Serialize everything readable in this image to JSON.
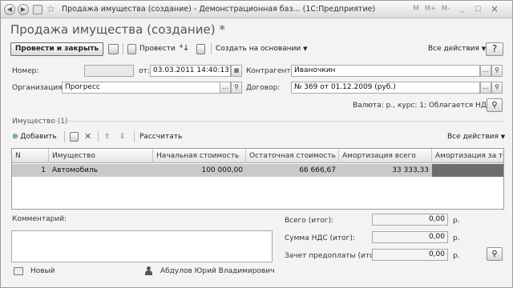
{
  "window": {
    "title": "Продажа имущества (создание) - Демонстрационная баз... (1С:Предприятие)",
    "controls": {
      "m": "M",
      "m_plus": "M+",
      "m_minus": "M-",
      "minimize": "_",
      "maximize": "□",
      "close": "×"
    }
  },
  "form": {
    "title": "Продажа имущества (создание) *"
  },
  "toolbar": {
    "post_and_close": "Провести и закрыть",
    "post": "Провести",
    "create_based_on": "Создать на основании",
    "all_actions": "Все действия"
  },
  "fields": {
    "number_label": "Номер:",
    "number_value": "",
    "date_label": "от:",
    "date_value": "03.03.2011 14:40:13",
    "org_label": "Организация:",
    "org_value": "Прогресс",
    "counterparty_label": "Контрагент:",
    "counterparty_value": "Иваночкин",
    "contract_label": "Договор:",
    "contract_value": "№ 369 от 01.12.2009 (руб.)",
    "currency_info": "Валюта: р., курс: 1; Облагается НДС"
  },
  "assets_section": {
    "title": "Имущество (1)",
    "add": "Добавить",
    "calculate": "Рассчитать",
    "all_actions": "Все действия"
  },
  "table": {
    "columns": [
      "N",
      "Имущество",
      "Начальная стоимость",
      "Остаточная стоимость",
      "Амортизация всего",
      "Амортизация за тек"
    ],
    "rows": [
      [
        "1",
        "Автомобиль",
        "100 000,00",
        "66 666,67",
        "33 333,33",
        ""
      ]
    ]
  },
  "comment": {
    "label": "Комментарий:",
    "value": ""
  },
  "totals": {
    "total_label": "Всего (итог):",
    "total_value": "0,00",
    "vat_label": "Сумма НДС (итог):",
    "vat_value": "0,00",
    "prepay_label": "Зачет предоплаты (итог):",
    "prepay_value": "0,00",
    "currency": "р."
  },
  "status": {
    "state": "Новый",
    "author": "Абдулов Юрий Владимирович"
  },
  "icons": {
    "back": "arrow-left-icon",
    "forward": "arrow-right-icon",
    "favorite": "star-icon",
    "save": "save-icon",
    "post": "post-icon",
    "choose": "ellipsis-icon",
    "search": "search-icon",
    "add": "add-icon",
    "copy": "copy-icon",
    "delete": "delete-icon",
    "up": "arrow-up-icon",
    "down": "arrow-down-icon"
  }
}
